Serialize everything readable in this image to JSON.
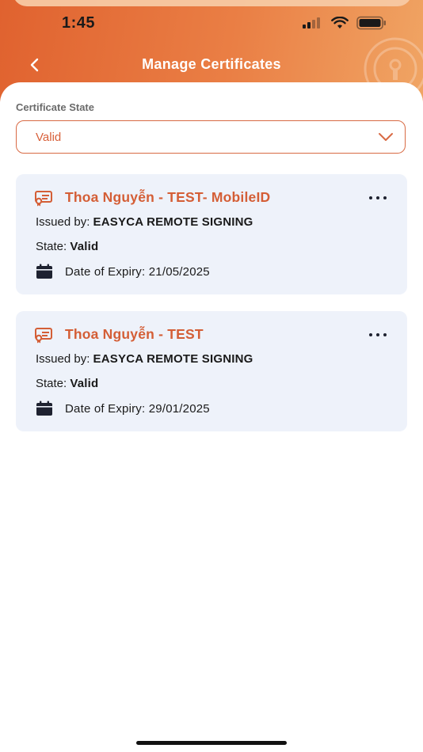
{
  "status_bar": {
    "time": "1:45"
  },
  "header": {
    "title": "Manage Certificates",
    "back_icon": "chevron-left-icon"
  },
  "filter": {
    "label": "Certificate State",
    "selected": "Valid",
    "chevron_icon": "chevron-down-icon"
  },
  "certificates": [
    {
      "name": "Thoa Nguyễn - TEST- MobileID",
      "issued_label": "Issued by:",
      "issuer": "EASYCA REMOTE SIGNING",
      "state_label": "State:",
      "state": "Valid",
      "expiry_label": "Date of Expiry:",
      "expiry": "21/05/2025"
    },
    {
      "name": "Thoa Nguyễn - TEST",
      "issued_label": "Issued by:",
      "issuer": "EASYCA REMOTE SIGNING",
      "state_label": "State:",
      "state": "Valid",
      "expiry_label": "Date of Expiry:",
      "expiry": "29/01/2025"
    }
  ],
  "colors": {
    "accent": "#d45e36",
    "header_gradient_start": "#e0622f",
    "header_gradient_end": "#f0a564",
    "card_background": "#eef2fa"
  }
}
